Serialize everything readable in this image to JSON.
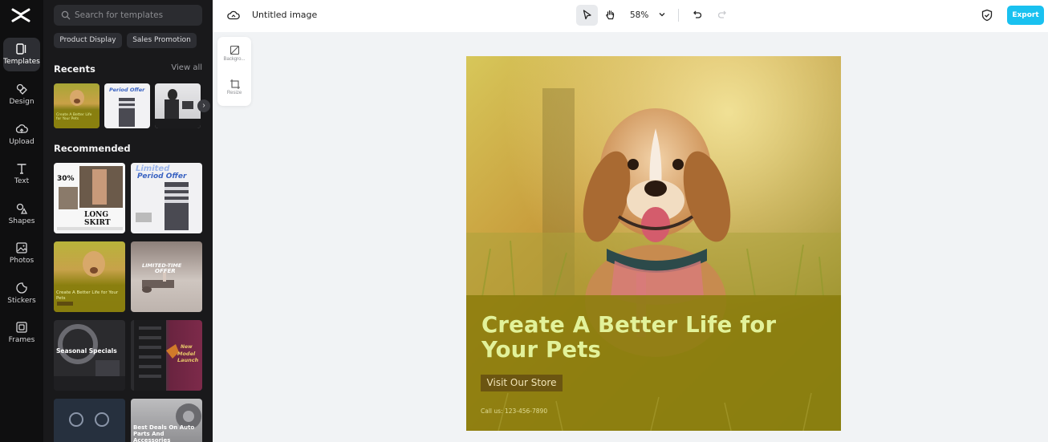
{
  "rail": {
    "items": [
      {
        "label": "Templates",
        "icon": "templates-icon",
        "active": true
      },
      {
        "label": "Design",
        "icon": "design-icon"
      },
      {
        "label": "Upload",
        "icon": "upload-icon"
      },
      {
        "label": "Text",
        "icon": "text-icon"
      },
      {
        "label": "Shapes",
        "icon": "shapes-icon"
      },
      {
        "label": "Photos",
        "icon": "photos-icon"
      },
      {
        "label": "Stickers",
        "icon": "stickers-icon"
      },
      {
        "label": "Frames",
        "icon": "frames-icon"
      }
    ]
  },
  "panel": {
    "search_placeholder": "Search for templates",
    "chips": [
      "Product Display",
      "Sales Promotion"
    ],
    "recents_title": "Recents",
    "view_all": "View all",
    "recommended_title": "Recommended",
    "recents": [
      {
        "caption": "Create A Better Life for Your Pets"
      },
      {
        "caption": "Period Offer"
      },
      {
        "caption": ""
      }
    ],
    "recommended": [
      {
        "top": "30%",
        "main": "LONG SKIRT"
      },
      {
        "top": "Limited",
        "main": "Period Offer"
      },
      {
        "main": "Create A Better Life for Your Pets"
      },
      {
        "top": "LIMITED-TIME",
        "main": "OFFER"
      },
      {
        "main": "Seasonal Specials"
      },
      {
        "top": "New",
        "main": "Model Launch"
      },
      {
        "main": ""
      },
      {
        "main": "Best Deals On Auto Parts And Accessories"
      }
    ]
  },
  "topbar": {
    "doc_title": "Untitled image",
    "zoom": "58%",
    "export_label": "Export"
  },
  "float": {
    "background_label": "Backgro...",
    "resize_label": "Resize"
  },
  "canvas": {
    "headline": "Create A Better Life for Your Pets",
    "button": "Visit Our Store",
    "callus": "Call us: 123-456-7890"
  },
  "colors": {
    "accent": "#19c1f0",
    "rail_bg": "#0f0f10",
    "panel_bg": "#19191b",
    "headline": "#e2f29a",
    "overlay": "#8a7c0c"
  }
}
